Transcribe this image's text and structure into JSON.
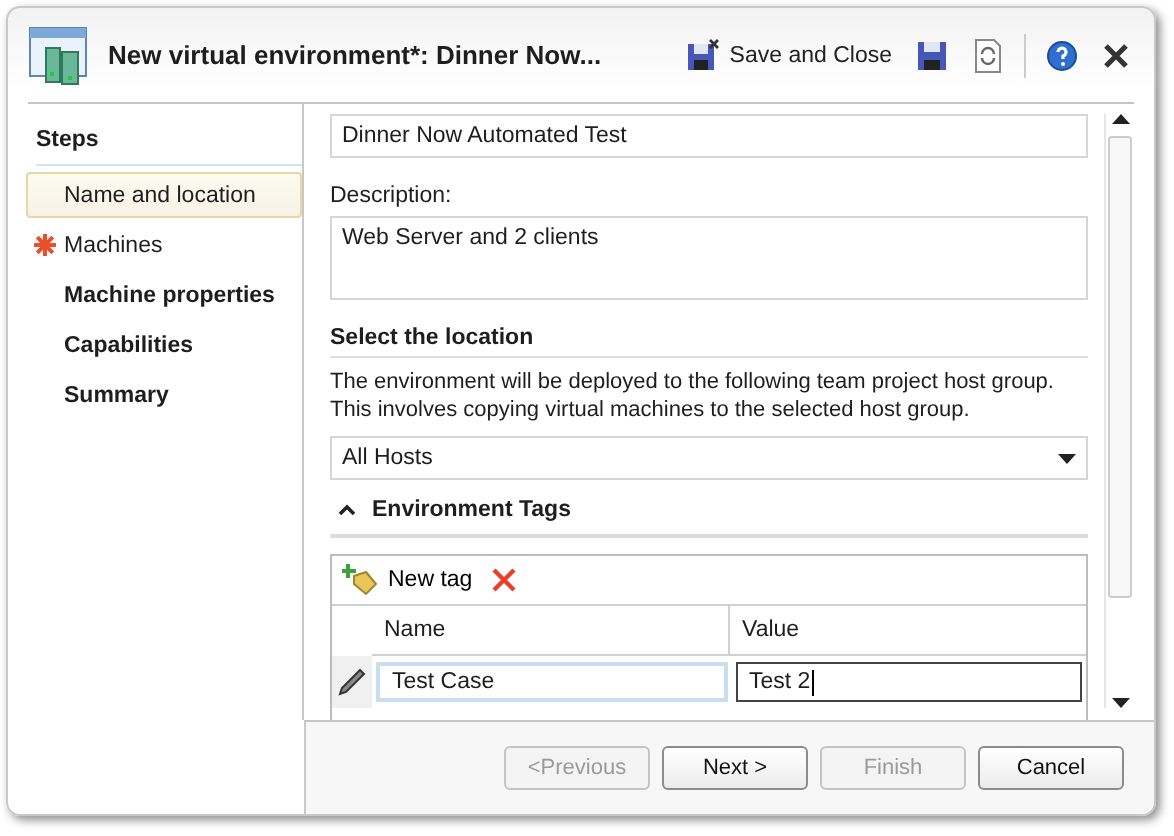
{
  "window": {
    "title": "New virtual environment*: Dinner Now..."
  },
  "toolbar": {
    "save_and_close": "Save and Close"
  },
  "steps": {
    "heading": "Steps",
    "items": [
      {
        "label": "Name and location",
        "selected": true,
        "error": false,
        "pending": false
      },
      {
        "label": "Machines",
        "selected": false,
        "error": true,
        "pending": false
      },
      {
        "label": "Machine properties",
        "selected": false,
        "error": false,
        "pending": true
      },
      {
        "label": "Capabilities",
        "selected": false,
        "error": false,
        "pending": true
      },
      {
        "label": "Summary",
        "selected": false,
        "error": false,
        "pending": true
      }
    ]
  },
  "form": {
    "name_value": "Dinner Now Automated Test",
    "description_label": "Description:",
    "description_value": "Web Server and 2 clients",
    "location_heading": "Select the location",
    "location_text": "The environment will be deployed to the following team project host group. This involves copying virtual machines to the selected host group.",
    "host_group": "All Hosts"
  },
  "tags": {
    "heading": "Environment Tags",
    "expanded": true,
    "new_tag": "New tag",
    "columns": [
      "Name",
      "Value"
    ],
    "rows": [
      {
        "name": "Test Case",
        "value": "Test 2",
        "editing": true
      }
    ]
  },
  "buttons": [
    {
      "label": "<Previous",
      "disabled": true
    },
    {
      "label": "Next >",
      "disabled": false
    },
    {
      "label": "Finish",
      "disabled": true
    },
    {
      "label": "Cancel",
      "disabled": false
    }
  ]
}
